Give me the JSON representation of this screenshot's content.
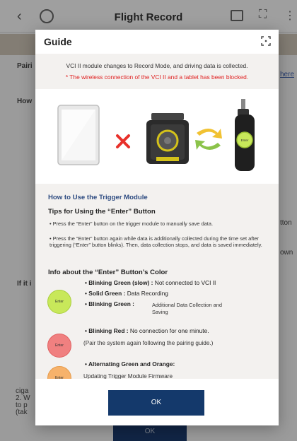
{
  "app": {
    "title": "Flight Record",
    "bg_texts": [
      "Pairi",
      "How",
      "If it i",
      "here",
      "tton",
      "own",
      "ciga",
      "2. W",
      "to p",
      "(tak"
    ],
    "bg_ok": "OK"
  },
  "modal": {
    "title": "Guide",
    "intro": "VCI II module changes to Record Mode, and driving data is collected.",
    "warning": "* The wireless connection of the VCI II and a tablet has been blocked.",
    "illustration": {
      "connection_icon": "x-icon",
      "sync_icon": "sync-arrows-icon",
      "trigger_label": "Enter"
    },
    "howto_title": "How to Use the Trigger Module",
    "tips_title": "Tips for Using the “Enter” Button",
    "tip1": "• Press the “Enter” button on the trigger module to manually save data.",
    "tip2": "• Press the “Enter” button again while data is additionally collected during the time set after triggering (“Enter” button blinks). Then, data collection stops, and data is saved immediately.",
    "info_title": "Info about the “Enter” Button’s Color",
    "colors": {
      "green": {
        "button_label": "Enter",
        "blink_slow_label": "• Blinking Green (slow) :",
        "blink_slow_desc": " Not connected to VCI II",
        "solid_label": "• Solid Green :",
        "solid_desc": " Data Recording",
        "blink_label": "• Blinking Green :",
        "blink_desc_1": "Additional Data Collection and",
        "blink_desc_2": "Saving"
      },
      "red": {
        "button_label": "Enter",
        "label": "• Blinking Red :",
        "desc": " No connection for one minute.",
        "note": "(Pair the system again following the pairing guide.)"
      },
      "orange": {
        "button_label": "Enter",
        "label": "• Alternating Green and Orange:",
        "desc": "Updating Trigger Module Firmware"
      }
    },
    "ok_label": "OK"
  },
  "theme": {
    "primary": "#14396b",
    "warning": "#e02020",
    "green": "#c8e85a",
    "red": "#f08080",
    "orange": "#f6b26b"
  }
}
